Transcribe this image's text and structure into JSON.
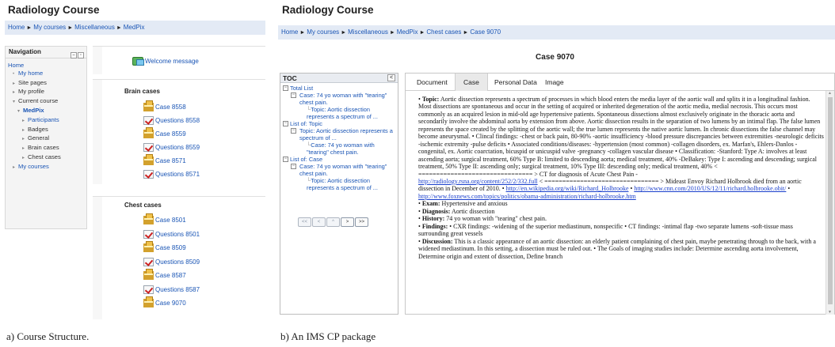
{
  "panel_a": {
    "site_title": "Radiology Course",
    "breadcrumb": [
      "Home",
      "My courses",
      "Miscellaneous",
      "MedPix"
    ],
    "breadcrumb_sep": "►",
    "navigation": {
      "title": "Navigation",
      "items": [
        {
          "label": "Home",
          "marker": "",
          "level": 0,
          "style": "link"
        },
        {
          "label": "My home",
          "marker": "•",
          "level": 1,
          "style": "link"
        },
        {
          "label": "Site pages",
          "marker": "▸",
          "level": 1,
          "style": "plain"
        },
        {
          "label": "My profile",
          "marker": "▸",
          "level": 1,
          "style": "plain"
        },
        {
          "label": "Current course",
          "marker": "▾",
          "level": 1,
          "style": "plain"
        },
        {
          "label": "MedPix",
          "marker": "▾",
          "level": 2,
          "style": "bold"
        },
        {
          "label": "Participants",
          "marker": "▸",
          "level": 3,
          "style": "link"
        },
        {
          "label": "Badges",
          "marker": "▸",
          "level": 3,
          "style": "plain"
        },
        {
          "label": "General",
          "marker": "▸",
          "level": 3,
          "style": "plain"
        },
        {
          "label": "Brain cases",
          "marker": "▸",
          "level": 3,
          "style": "plain"
        },
        {
          "label": "Chest cases",
          "marker": "▸",
          "level": 3,
          "style": "plain"
        },
        {
          "label": "My courses",
          "marker": "▸",
          "level": 1,
          "style": "link"
        }
      ]
    },
    "welcome_label": "Welcome message",
    "brain_section": {
      "title": "Brain cases",
      "items": [
        {
          "label": "Case 8558",
          "icon": "resource-icon"
        },
        {
          "label": "Questions 8558",
          "icon": "quiz-icon"
        },
        {
          "label": "Case 8559",
          "icon": "resource-icon"
        },
        {
          "label": "Questions 8559",
          "icon": "quiz-icon"
        },
        {
          "label": "Case 8571",
          "icon": "resource-icon"
        },
        {
          "label": "Questions 8571",
          "icon": "quiz-icon"
        }
      ]
    },
    "chest_section": {
      "title": "Chest cases",
      "items": [
        {
          "label": "Case 8501",
          "icon": "resource-icon"
        },
        {
          "label": "Questions 8501",
          "icon": "quiz-icon"
        },
        {
          "label": "Case 8509",
          "icon": "resource-icon"
        },
        {
          "label": "Questions 8509",
          "icon": "quiz-icon"
        },
        {
          "label": "Case 8587",
          "icon": "resource-icon"
        },
        {
          "label": "Questions 8587",
          "icon": "quiz-icon"
        },
        {
          "label": "Case 9070",
          "icon": "resource-icon"
        }
      ]
    },
    "caption": "a) Course Structure."
  },
  "panel_b": {
    "site_title": "Radiology Course",
    "breadcrumb": [
      "Home",
      "My courses",
      "Miscellaneous",
      "MedPix",
      "Chest cases",
      "Case 9070"
    ],
    "case_title": "Case 9070",
    "toc": {
      "title": "TOC",
      "collapse_glyph": "<",
      "items": [
        {
          "label": "Total List",
          "level": 0,
          "box": "−"
        },
        {
          "label": "Case: 74 yo woman with \"tearing\" chest pain.",
          "level": 1,
          "box": "−"
        },
        {
          "label": "Topic: Aortic dissection represents a spectrum of ...",
          "level": 2,
          "box": ""
        },
        {
          "label": "List of: Topic",
          "level": 0,
          "box": "−"
        },
        {
          "label": "Topic: Aortic dissection represents a spectrum of ...",
          "level": 1,
          "box": "−"
        },
        {
          "label": "Case: 74 yo woman with \"tearing\" chest pain.",
          "level": 2,
          "box": ""
        },
        {
          "label": "List of: Case",
          "level": 0,
          "box": "−"
        },
        {
          "label": "Case: 74 yo woman with \"tearing\" chest pain.",
          "level": 1,
          "box": "−"
        },
        {
          "label": "Topic: Aortic dissection represents a spectrum of ...",
          "level": 2,
          "box": ""
        }
      ],
      "pager": [
        "<<",
        "<",
        "^",
        ">",
        ">>"
      ]
    },
    "tabs": [
      "Document",
      "Case",
      "Personal Data",
      "Image"
    ],
    "active_tab": "Case",
    "document": {
      "topic_label": "Topic:",
      "topic_text": "Aortic dissection represents a spectrum of processes in which blood enters the media layer of the aortic wall and splits it in a longitudinal fashion. Most dissections are spontaneous and occur in the setting of acquired or inherited degeneration of the aortic media, medial necrosis. This occurs most commonly as an acquired lesion in mid-old age hypertensive patients. Spontaneous dissections almost exclusively originate in the thoracic aorta and secondarily involve the abdominal aorta by extension from above. Aortic dissection results in the separation of two lumens by an intimal flap. The false lumen represents the space created by the splitting of the aortic wall; the true lumen represents the native aortic lumen. In chronic dissections the false channel may become aneurysmal. • Clincal findings: -chest or back pain, 80-90% -aortic insufficiency -blood pressure discrepancies between extremities -neurologic deficits -ischemic extremity -pulse deficits • Associated conditions/diseases: -hypertension (most common) -collagen disorders, ex. Marfan's, Ehlers-Danlos -congenital, ex. Aortic coarctation, bicuspid or unicuspid valve -pregnancy -collagen vascular disease • Classification: -Stanford: Type A: involves at least ascending aorta; surgical treatment, 60% Type B: limited to descending aorta; medical treatment, 40% -DeBakey: Type I: ascending and descending; surgical treatment, 50% Type II: ascending only; surgical treatment, 10% Type III: descending only; medical treatment, 40% < ================================ > CT for diagnosis of Acute Chest Pain -",
      "link1": "http://radiology.rsna.org/content/252/2/332.full",
      "mid_text": " < ================================ > Mideast Envoy Richard Holbrook died from an aortic dissection in December of 2010. • ",
      "link2": "http://en.wikipedia.org/wiki/Richard_Holbrooke",
      "bullet": " • ",
      "link3": "http://www.cnn.com/2010/US/12/11/richard.holbrooke.obit/",
      "link4": "http://www.foxnews.com/topics/politics/obama-administration/richard-holbrooke.htm",
      "exam_label": "Exam:",
      "exam_text": "Hypertensive and anxious",
      "diagnosis_label": "Diagnosis:",
      "diagnosis_text": "Aortic dissection",
      "history_label": "History:",
      "history_text": "74 yo woman with \"tearing\" chest pain.",
      "findings_label": "Findings:",
      "findings_text": "• CXR findings: -widening of the superior mediastinum, nonspecific • CT findings: -intimal flap -two separate lumens -soft-tissue mass surrounding great vessels",
      "discussion_label": "Discussion:",
      "discussion_text": "This is a classic appearance of an aortic dissection: an elderly patient complaining of chest pain, maybe penetrating through to the back, with a widened mediastinum. In this setting, a dissection must be ruled out. • The Goals of imaging studies include: Determine ascending aorta involvement, Determine origin and extent of dissection, Define branch"
    },
    "caption": "b) An IMS CP package"
  }
}
